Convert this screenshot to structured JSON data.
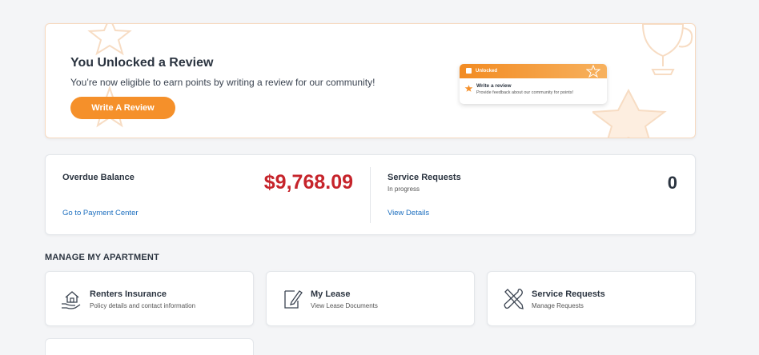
{
  "promo": {
    "title": "You Unlocked a Review",
    "description": "You’re now eligible to earn points by writing a review for our community!",
    "button": "Write A Review",
    "mini_card": {
      "header": "Unlocked",
      "title": "Write a review",
      "subtitle": "Provide feedback about our community for points!"
    },
    "accent_color": "#f5902a"
  },
  "balance": {
    "label": "Overdue Balance",
    "amount": "$9,768.09",
    "link": "Go to Payment Center",
    "amount_color": "#c6242b"
  },
  "service_requests": {
    "label": "Service Requests",
    "status": "In progress",
    "count": "0",
    "link": "View Details"
  },
  "manage": {
    "title": "MANAGE MY APARTMENT",
    "tiles": [
      {
        "icon": "house-hand-icon",
        "title": "Renters Insurance",
        "subtitle": "Policy details and contact information"
      },
      {
        "icon": "document-pen-icon",
        "title": "My Lease",
        "subtitle": "View Lease Documents"
      },
      {
        "icon": "tools-icon",
        "title": "Service Requests",
        "subtitle": "Manage Requests"
      }
    ]
  }
}
